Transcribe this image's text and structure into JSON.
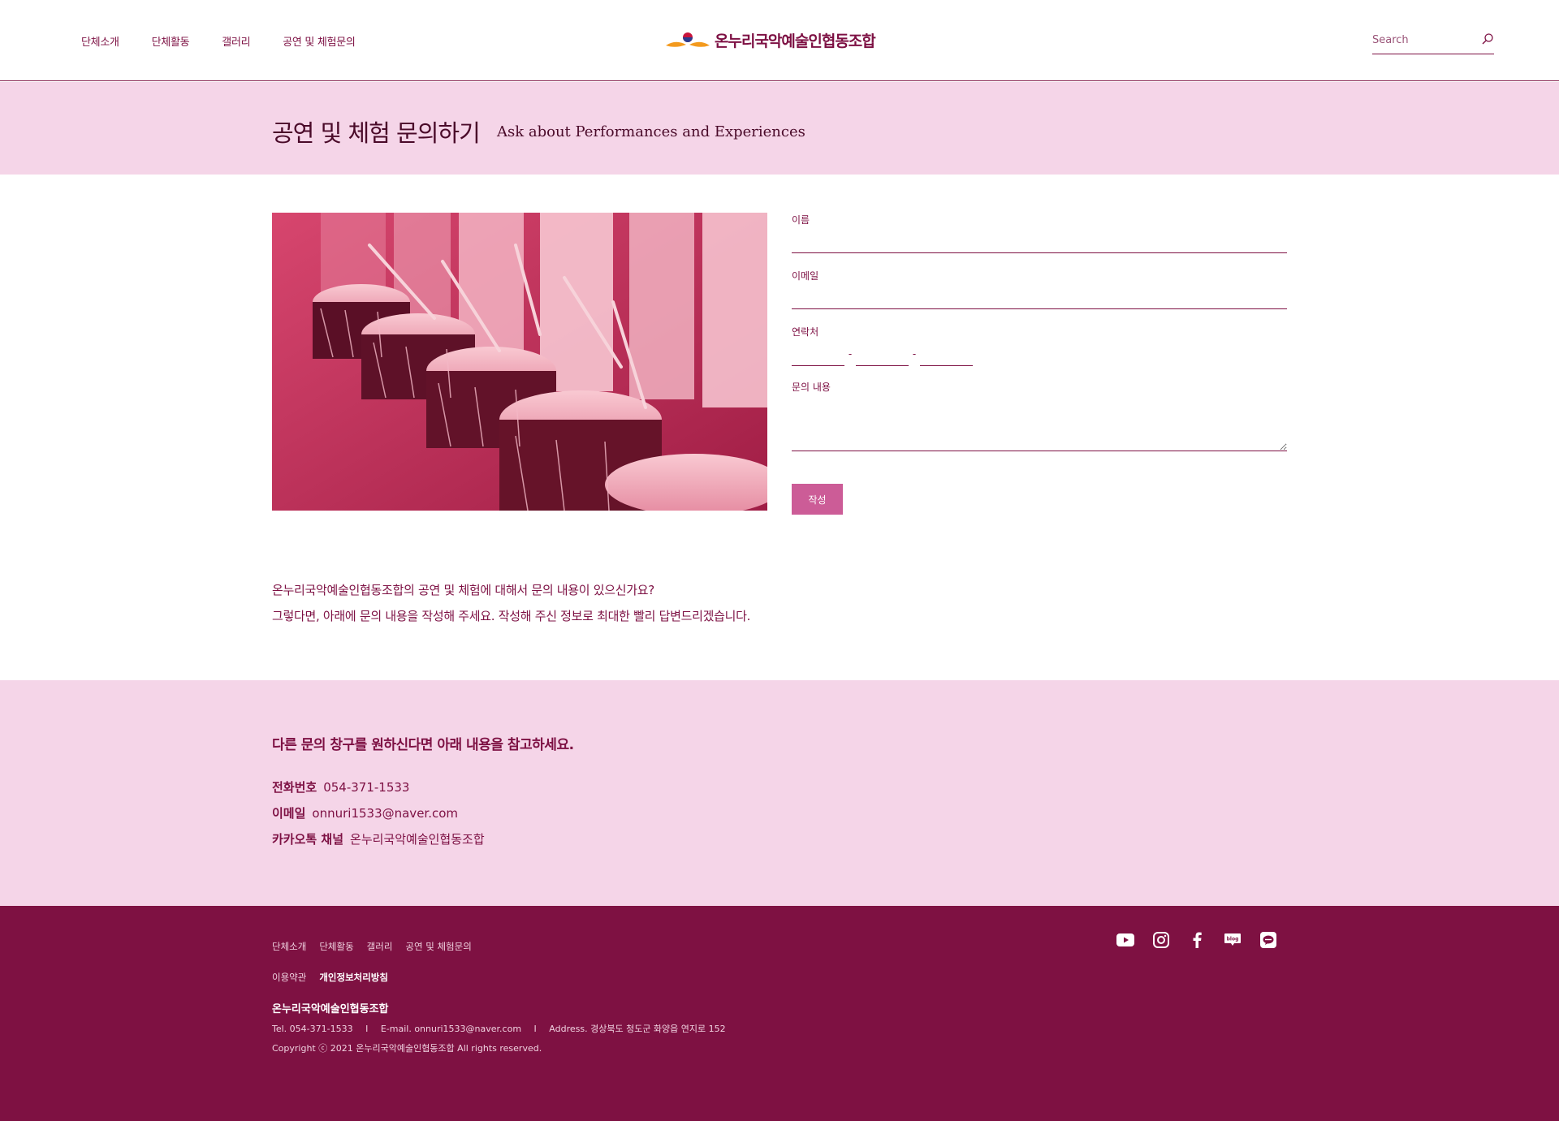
{
  "header": {
    "nav": [
      "단체소개",
      "단체활동",
      "갤러리",
      "공연 및 체험문의"
    ],
    "logo_text": "온누리국악예술인협동조합",
    "search_placeholder": "Search"
  },
  "title_band": {
    "title_ko": "공연 및 체험 문의하기",
    "title_en": "Ask about Performances and Experiences"
  },
  "form": {
    "name_label": "이름",
    "email_label": "이메일",
    "phone_label": "연락처",
    "phone_dash": "-",
    "message_label": "문의 내용",
    "submit_label": "작성"
  },
  "intro": {
    "line1": "온누리국악예술인협동조합의 공연 및 체험에 대해서 문의 내용이 있으신가요?",
    "line2": "그렇다면, 아래에 문의 내용을 작성해 주세요. 작성해 주신 정보로 최대한 빨리 답변드리겠습니다."
  },
  "contact": {
    "heading": "다른 문의 창구를 원하신다면 아래 내용을 참고하세요.",
    "phone_label": "전화번호",
    "phone_value": "054-371-1533",
    "email_label": "이메일",
    "email_value": "onnuri1533@naver.com",
    "kakao_label": "카카오톡 채널",
    "kakao_value": "온누리국악예술인협동조합"
  },
  "footer": {
    "nav": [
      "단체소개",
      "단체활동",
      "갤러리",
      "공연 및 체험문의"
    ],
    "terms": "이용약관",
    "privacy": "개인정보처리방침",
    "org_name": "온누리국악예술인협동조합",
    "tel": "Tel. 054-371-1533",
    "sep": "I",
    "email": "E-mail. onnuri1533@naver.com",
    "address": "Address. 경상북도 청도군 화양읍 연지로 152",
    "copyright": "Copyright ⓒ 2021 온누리국악예술인협동조합 All rights reserved.",
    "social_icons": [
      "youtube-icon",
      "instagram-icon",
      "facebook-icon",
      "blog-icon",
      "kakao-talk-icon"
    ]
  },
  "colors": {
    "brand": "#7e1142",
    "pink_band": "#f5d5e8",
    "button": "#cc5c97",
    "logo_orange": "#f39a1e"
  }
}
